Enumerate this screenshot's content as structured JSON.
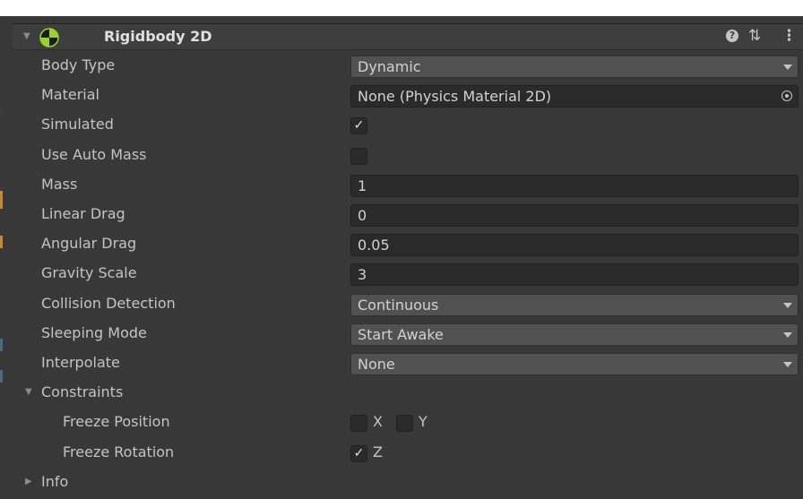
{
  "component": {
    "title": "Rigidbody 2D",
    "icon": "rigidbody2d-icon",
    "header_icons": [
      "help-icon",
      "presets-icon",
      "menu-icon"
    ]
  },
  "fields": {
    "body_type": {
      "label": "Body Type",
      "value": "Dynamic"
    },
    "material": {
      "label": "Material",
      "value": "None (Physics Material 2D)"
    },
    "simulated": {
      "label": "Simulated",
      "checked": true
    },
    "use_auto_mass": {
      "label": "Use Auto Mass",
      "checked": false
    },
    "mass": {
      "label": "Mass",
      "value": "1"
    },
    "linear_drag": {
      "label": "Linear Drag",
      "value": "0"
    },
    "angular_drag": {
      "label": "Angular Drag",
      "value": "0.05"
    },
    "gravity_scale": {
      "label": "Gravity Scale",
      "value": "3"
    },
    "collision_detection": {
      "label": "Collision Detection",
      "value": "Continuous"
    },
    "sleeping_mode": {
      "label": "Sleeping Mode",
      "value": "Start Awake"
    },
    "interpolate": {
      "label": "Interpolate",
      "value": "None"
    }
  },
  "constraints": {
    "label": "Constraints",
    "expanded": true,
    "freeze_position": {
      "label": "Freeze Position",
      "x_label": "X",
      "x_checked": false,
      "y_label": "Y",
      "y_checked": false
    },
    "freeze_rotation": {
      "label": "Freeze Rotation",
      "z_label": "Z",
      "z_checked": true
    }
  },
  "info": {
    "label": "Info",
    "expanded": false
  },
  "colors": {
    "panel_bg": "#383838",
    "field_bg": "#2a2a2a",
    "dropdown_bg": "#515151",
    "text": "#c4c4c4"
  }
}
